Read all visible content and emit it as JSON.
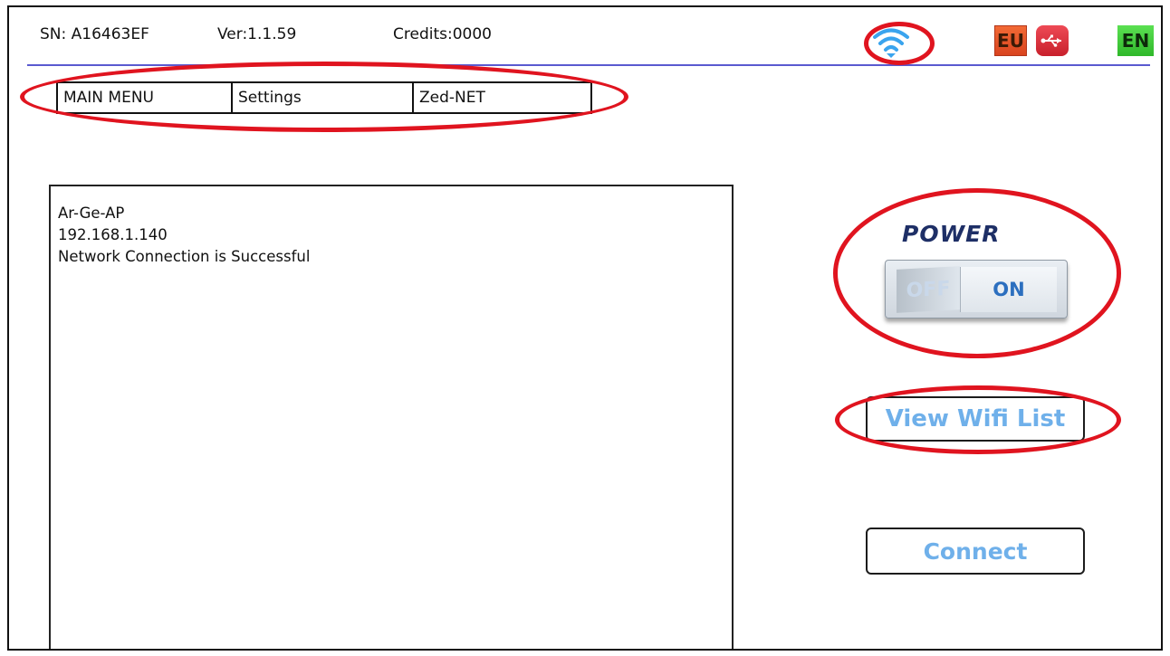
{
  "status_bar": {
    "serial": "SN: A16463EF",
    "version": "Ver:1.1.59",
    "credits": "Credits:0000",
    "icons": [
      "wifi-icon",
      "eu-region-icon",
      "usb-icon",
      "en-language-icon"
    ],
    "region_label": "EU",
    "language_label": "EN"
  },
  "menu": {
    "tabs": [
      {
        "label": "MAIN MENU"
      },
      {
        "label": "Settings"
      },
      {
        "label": "Zed-NET"
      }
    ]
  },
  "log": {
    "lines": [
      "Ar-Ge-AP",
      "192.168.1.140",
      "Network Connection is Successful"
    ]
  },
  "power": {
    "title": "POWER",
    "off_label": "OFF",
    "on_label": "ON",
    "state": "ON"
  },
  "buttons": {
    "view_wifi_list": "View Wifi List",
    "connect": "Connect"
  },
  "colors": {
    "annotation_red": "#e0141f",
    "divider": "#5a5ad0",
    "button_text": "#6fb0ea",
    "wifi": "#3aa4ee",
    "eu_bg": "#e8572a",
    "usb_bg": "#d8303c",
    "en_bg": "#3fc83a"
  }
}
